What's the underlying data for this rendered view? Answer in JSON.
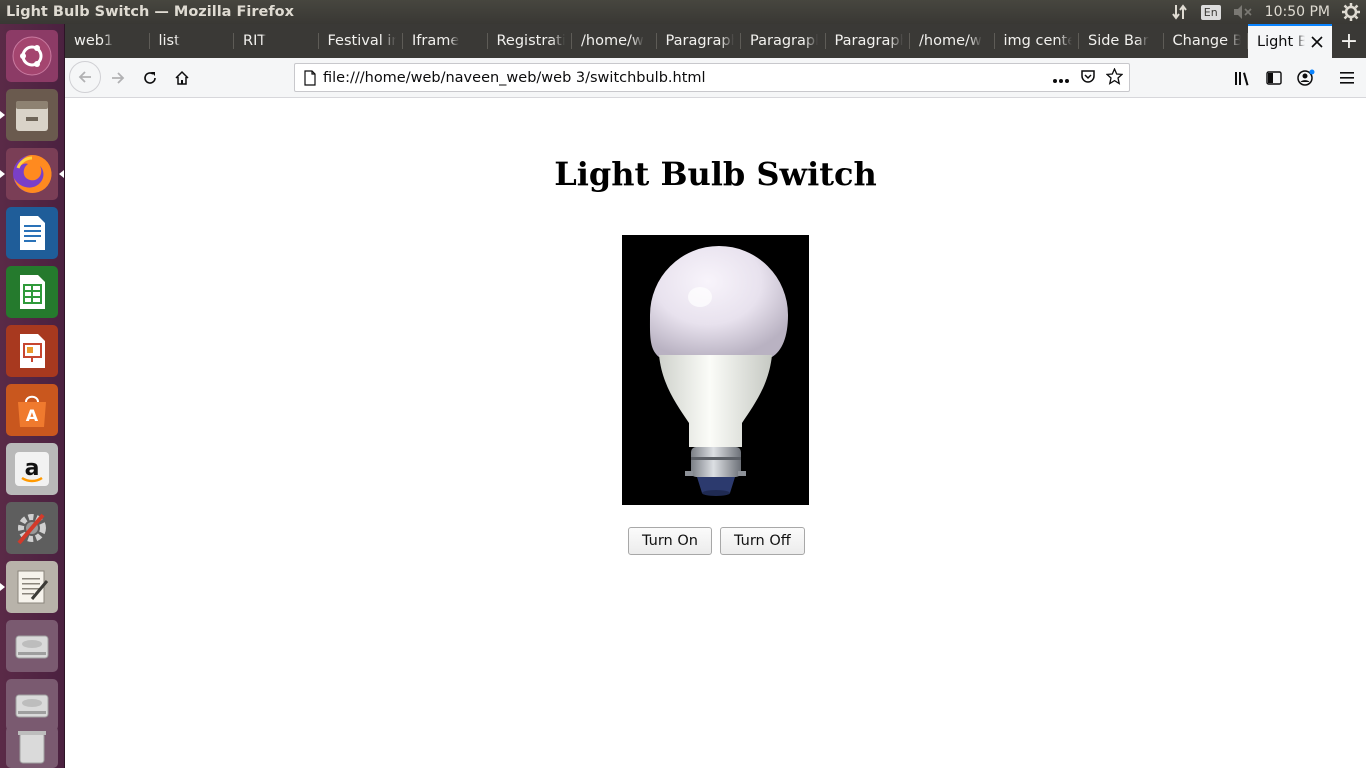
{
  "system": {
    "window_title": "Light Bulb Switch — Mozilla Firefox",
    "keyboard_layout": "En",
    "clock": "10:50 PM"
  },
  "launcher": {
    "items": [
      {
        "name": "ubuntu-dash-icon",
        "color": "#e95420"
      },
      {
        "name": "files-icon",
        "color": "#9b8f7e"
      },
      {
        "name": "firefox-icon",
        "color": "#ff7139"
      },
      {
        "name": "libreoffice-writer-icon",
        "color": "#2a72b8"
      },
      {
        "name": "libreoffice-calc-icon",
        "color": "#2f9a3a"
      },
      {
        "name": "libreoffice-impress-icon",
        "color": "#c7462f"
      },
      {
        "name": "ubuntu-software-icon",
        "color": "#e8742e"
      },
      {
        "name": "amazon-icon",
        "color": "#dcdcdc"
      },
      {
        "name": "system-settings-icon",
        "color": "#8a8a8a"
      },
      {
        "name": "text-editor-icon",
        "color": "#d8d4cc"
      },
      {
        "name": "drive-icon",
        "color": "#c8c8c8"
      },
      {
        "name": "drive-icon",
        "color": "#c8c8c8"
      },
      {
        "name": "trash-icon",
        "color": "#c8c8c8"
      }
    ]
  },
  "browser": {
    "tabs": [
      {
        "label": "web1"
      },
      {
        "label": "list"
      },
      {
        "label": "RIT"
      },
      {
        "label": "Festival in"
      },
      {
        "label": "Iframe"
      },
      {
        "label": "Registration"
      },
      {
        "label": "/home/w"
      },
      {
        "label": "Paragraph"
      },
      {
        "label": "Paragraph"
      },
      {
        "label": "Paragraph"
      },
      {
        "label": "/home/w"
      },
      {
        "label": "img center"
      },
      {
        "label": "Side Bar"
      },
      {
        "label": "Change B"
      },
      {
        "label": "Light Bulb Switch",
        "active": true
      }
    ],
    "new_tab_symbol": "+",
    "url": "file:///home/web/naveen_web/web 3/switchbulb.html",
    "accent_color": "#0a84ff"
  },
  "page": {
    "title": "Light Bulb Switch",
    "bulb_state": "off",
    "buttons": {
      "turn_on": "Turn On",
      "turn_off": "Turn Off"
    }
  }
}
